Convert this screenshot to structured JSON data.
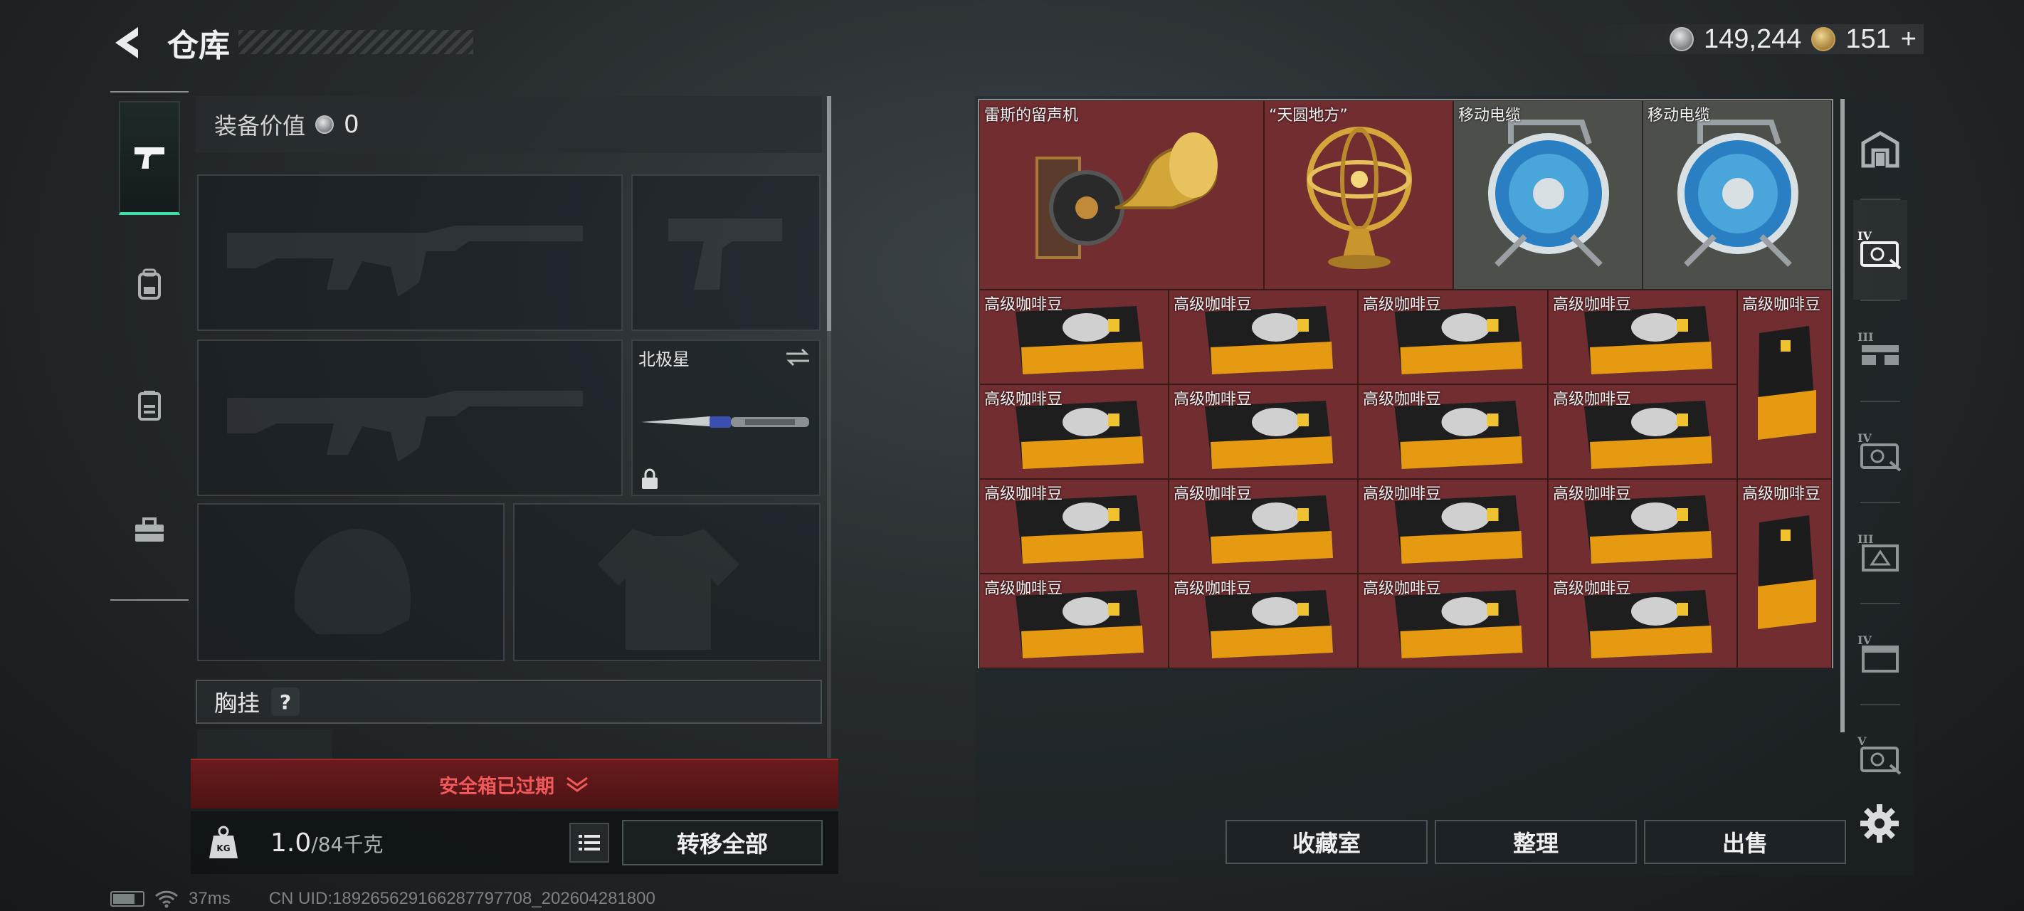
{
  "header": {
    "title": "仓库",
    "currency": [
      {
        "icon": "silver-coin-icon",
        "value": "149,244"
      },
      {
        "icon": "gold-coin-icon",
        "value": "151",
        "add": "+"
      }
    ]
  },
  "categories": [
    {
      "name": "weapons",
      "icon": "pistol-icon",
      "active": true
    },
    {
      "name": "backpack",
      "icon": "backpack-icon",
      "active": false
    },
    {
      "name": "vest",
      "icon": "vest-icon",
      "active": false
    },
    {
      "name": "case",
      "icon": "toolbox-icon",
      "active": false
    }
  ],
  "equipment": {
    "value_label": "装备价值",
    "value": "0",
    "melee": {
      "name": "北极星"
    },
    "chest_rig_label": "胸挂",
    "chest_rig_help": "?"
  },
  "safe_box": {
    "expired_text": "安全箱已过期"
  },
  "weight": {
    "current": "1.0",
    "max": "/84千克",
    "icon_text": "KG"
  },
  "buttons": {
    "transfer_all": "转移全部",
    "collection": "收藏室",
    "organize": "整理",
    "sell": "出售"
  },
  "status": {
    "latency": "37ms",
    "uid": "CN UID:18926562916628779770​8_202604281800"
  },
  "stash": {
    "items": [
      {
        "name": "雷斯的留声机",
        "type": "gramophone"
      },
      {
        "name": "“天圆地方”",
        "type": "armillary"
      },
      {
        "name": "移动电缆",
        "type": "cable-reel"
      },
      {
        "name": "移动电缆",
        "type": "cable-reel"
      },
      {
        "name": "高级咖啡豆",
        "type": "coffee-bag"
      },
      {
        "name": "高级咖啡豆",
        "type": "coffee-bag"
      },
      {
        "name": "高级咖啡豆",
        "type": "coffee-bag"
      },
      {
        "name": "高级咖啡豆",
        "type": "coffee-bag"
      },
      {
        "name": "高级咖啡豆",
        "type": "coffee-bag-tall"
      },
      {
        "name": "高级咖啡豆",
        "type": "coffee-bag"
      },
      {
        "name": "高级咖啡豆",
        "type": "coffee-bag"
      },
      {
        "name": "高级咖啡豆",
        "type": "coffee-bag"
      },
      {
        "name": "高级咖啡豆",
        "type": "coffee-bag"
      },
      {
        "name": "高级咖啡豆",
        "type": "coffee-bag"
      },
      {
        "name": "高级咖啡豆",
        "type": "coffee-bag"
      },
      {
        "name": "高级咖啡豆",
        "type": "coffee-bag"
      },
      {
        "name": "高级咖啡豆",
        "type": "coffee-bag"
      },
      {
        "name": "高级咖啡豆",
        "type": "coffee-bag-tall"
      },
      {
        "name": "高级咖啡豆",
        "type": "coffee-bag"
      },
      {
        "name": "高级咖啡豆",
        "type": "coffee-bag"
      },
      {
        "name": "高级咖啡豆",
        "type": "coffee-bag"
      },
      {
        "name": "高级咖啡豆",
        "type": "coffee-bag"
      }
    ]
  },
  "side_tabs": [
    {
      "icon": "stash-home-icon",
      "label": ""
    },
    {
      "icon": "case-tier-iv-icon",
      "label": "IV",
      "active": true
    },
    {
      "icon": "rig-tier-iii-icon",
      "label": "III"
    },
    {
      "icon": "case-tier-iv-icon",
      "label": "IV"
    },
    {
      "icon": "box-tier-iii-icon",
      "label": "III"
    },
    {
      "icon": "box-tier-iv-icon",
      "label": "IV"
    },
    {
      "icon": "case-tier-v-icon",
      "label": "V"
    }
  ],
  "colors": {
    "accent": "#3fe0a6",
    "stash_bg": "#722d31",
    "danger": "#f0595b"
  }
}
